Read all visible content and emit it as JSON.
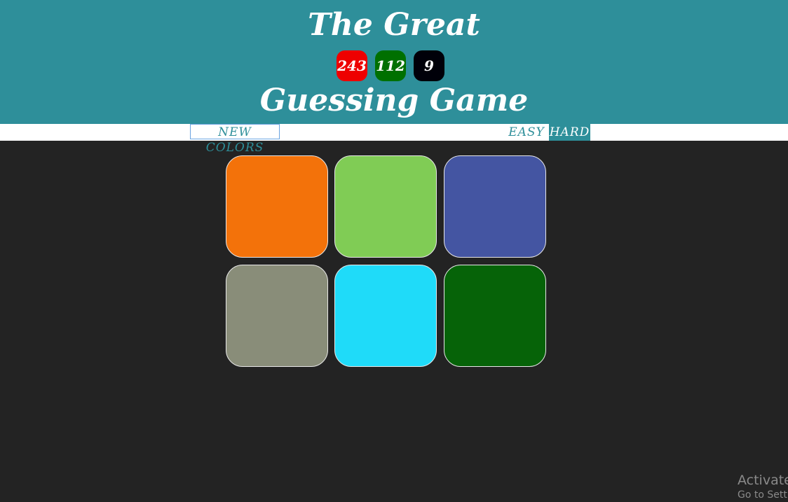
{
  "header": {
    "title_top": "The Great",
    "title_bottom": "Guessing Game",
    "rgb": [
      {
        "value": "243",
        "color": "#ee0000"
      },
      {
        "value": "112",
        "color": "#007000"
      },
      {
        "value": "9",
        "color": "#000009"
      }
    ],
    "background": "#2e8f9a"
  },
  "controls": {
    "new_colors_label": "NEW COLORS",
    "easy_label": "EASY",
    "hard_label": "HARD",
    "selected_mode": "HARD"
  },
  "board": {
    "squares": [
      {
        "color": "#f3720a"
      },
      {
        "color": "#80cc55"
      },
      {
        "color": "#4455a2"
      },
      {
        "color": "#898d79"
      },
      {
        "color": "#1fdbf9"
      },
      {
        "color": "#066308"
      }
    ]
  },
  "watermark": {
    "line1": "Activate",
    "line2": "Go to Setti"
  }
}
